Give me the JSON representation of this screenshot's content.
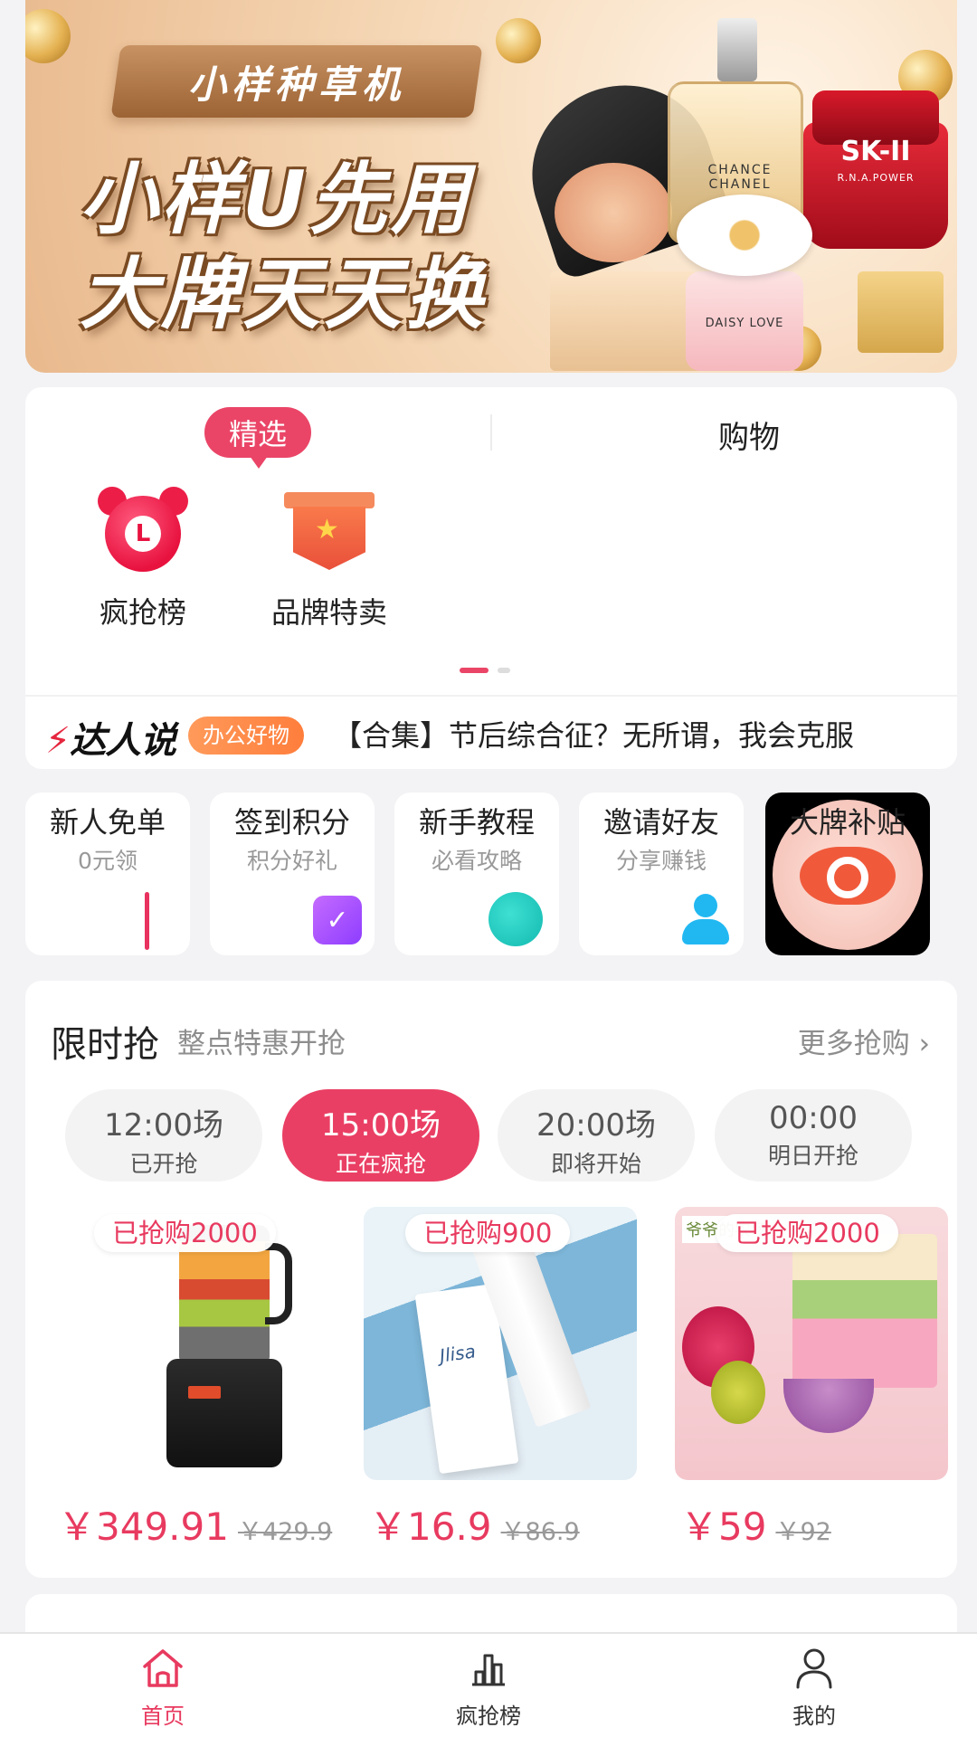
{
  "banner": {
    "ribbon_text": "小样种草机",
    "slogan_line1": "小样U先用",
    "slogan_line2": "大牌天天换",
    "perfume_label": "CHANCE CHANEL",
    "skii_label": "SK-II",
    "skii_sub": "R.N.A.POWER",
    "daisy_label": "DAISY LOVE"
  },
  "category_tabs": {
    "selected": "精选",
    "other": "购物"
  },
  "categories": [
    {
      "label": "疯抢榜",
      "icon": "alarm-clock-icon",
      "icon_letter": "L"
    },
    {
      "label": "品牌特卖",
      "icon": "brand-shield-icon"
    }
  ],
  "daren": {
    "logo": "达人说",
    "tag": "办公好物",
    "text": "【合集】节后综合征？无所谓，我会克服"
  },
  "quick_entries": [
    {
      "title": "新人免单",
      "subtitle": "0元领"
    },
    {
      "title": "签到积分",
      "subtitle": "积分好礼"
    },
    {
      "title": "新手教程",
      "subtitle": "必看攻略"
    },
    {
      "title": "邀请好友",
      "subtitle": "分享赚钱"
    },
    {
      "title": "大牌补贴"
    }
  ],
  "flash_sale": {
    "title": "限时抢",
    "subtitle": "整点特惠开抢",
    "more": "更多抢购",
    "sessions": [
      {
        "time": "12:00场",
        "status": "已开抢",
        "active": false
      },
      {
        "time": "15:00场",
        "status": "正在疯抢",
        "active": true
      },
      {
        "time": "20:00场",
        "status": "即将开始",
        "active": false
      },
      {
        "time": "00:00",
        "status": "明日开抢",
        "active": false
      }
    ],
    "products": [
      {
        "sold": "已抢购2000",
        "price": "￥349.91",
        "original": "￥429.9"
      },
      {
        "sold": "已抢购900",
        "price": "￥16.9",
        "original": "￥86.9",
        "brand": "Jlisa"
      },
      {
        "sold": "已抢购2000",
        "price": "￥59",
        "original": "￥92",
        "logo": "爷爷的农场"
      }
    ]
  },
  "bottom_nav": [
    {
      "label": "首页",
      "active": true
    },
    {
      "label": "疯抢榜",
      "active": false
    },
    {
      "label": "我的",
      "active": false
    }
  ],
  "colors": {
    "accent": "#ea3f64",
    "page_bg": "#f3f3f5"
  }
}
